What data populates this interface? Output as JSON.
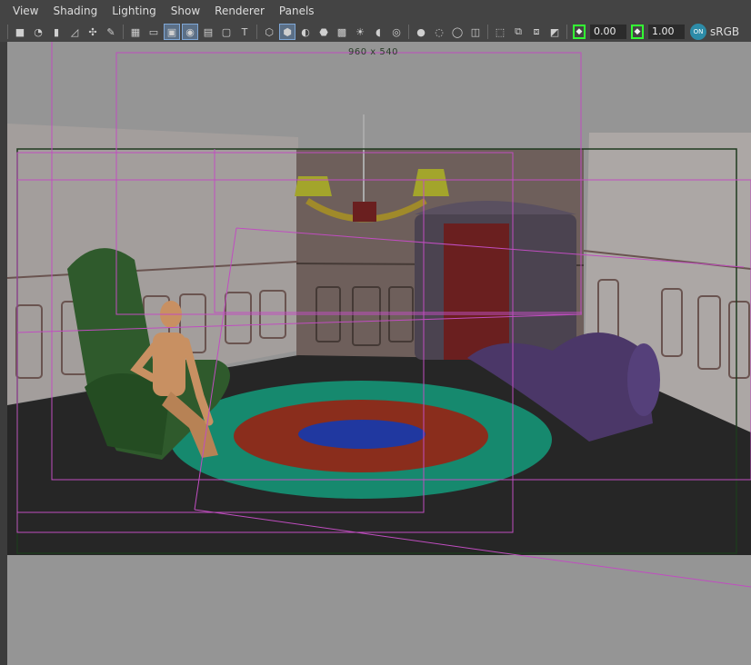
{
  "menubar": {
    "items": [
      "View",
      "Shading",
      "Lighting",
      "Show",
      "Renderer",
      "Panels"
    ]
  },
  "toolbar": {
    "exposure_value": "0.00",
    "gamma_value": "1.00",
    "color_space": "sRGB",
    "on_badge": "ON"
  },
  "viewport": {
    "resolution_label": "960 x 540"
  },
  "colors": {
    "background": "#939393",
    "resolution_gate": "#c04dc0",
    "film_gate": "#1f3a1f",
    "selected_tool": "#5b6f86"
  }
}
